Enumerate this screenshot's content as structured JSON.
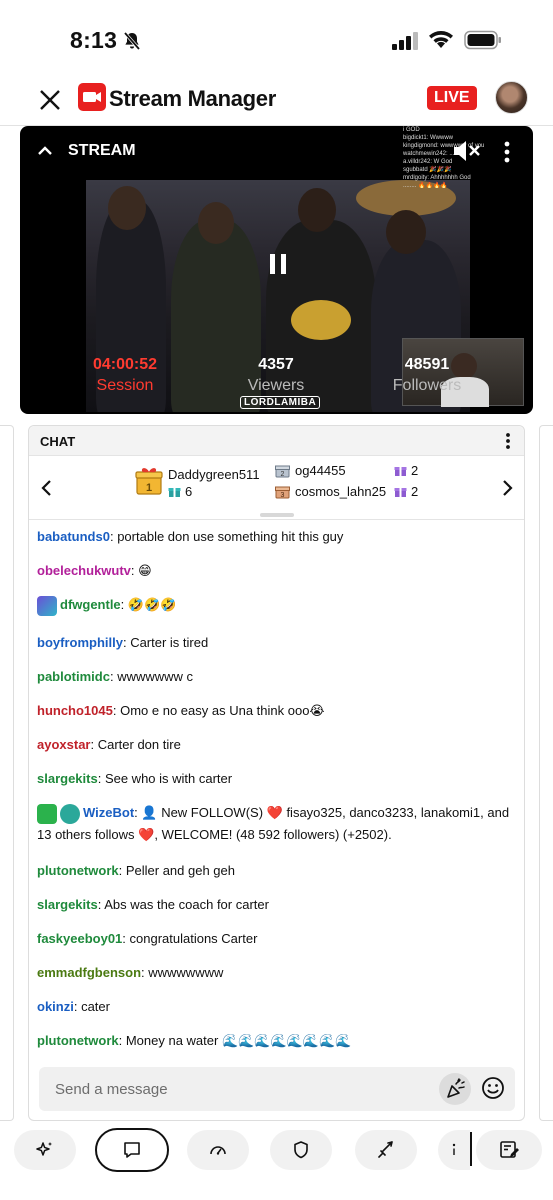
{
  "status": {
    "time": "8:13"
  },
  "header": {
    "title": "Stream Manager",
    "live": "LIVE"
  },
  "stream": {
    "section_label": "STREAM",
    "stats": [
      {
        "value": "04:00:52",
        "label": "Session"
      },
      {
        "value": "4357",
        "label": "Viewers"
      },
      {
        "value": "48591",
        "label": "Followers"
      }
    ],
    "watermark": "LORDLAMIBA",
    "mini_chat": [
      "i GOD",
      "bigdickt1: Wwwww",
      "kingdigmond: wwwwww of you",
      "watchmewin242: ......",
      "a.villdr242: W God",
      "sgubbatd 🎉🎉🎉",
      "mrdlgoity: Ahhhhhhh God",
      "........ 🔥🔥🔥🔥"
    ]
  },
  "chat": {
    "title": "CHAT",
    "gifters": [
      {
        "name": "Daddygreen511",
        "count": "6",
        "rank": "1"
      },
      {
        "name": "og44455",
        "count": "2",
        "rank": "2"
      },
      {
        "name": "cosmos_lahn25",
        "count": "2",
        "rank": "3"
      }
    ],
    "messages": [
      {
        "user": "babatunds0",
        "color": "#1a5ec2",
        "text": "portable don use something hit this guy"
      },
      {
        "user": "obelechukwutv",
        "color": "#b2209a",
        "text": "😁"
      },
      {
        "user": "dfwgentle",
        "color": "#1f8a3c",
        "text": "🤣🤣🤣"
      },
      {
        "user": "boyfromphilly",
        "color": "#1a5ec2",
        "text": "Carter is tired"
      },
      {
        "user": "pablotimidc",
        "color": "#1f8a3c",
        "text": "wwwwwww c"
      },
      {
        "user": "huncho1045",
        "color": "#c0222a",
        "text": "Omo e no easy as Una think ooo😭"
      },
      {
        "user": "ayoxstar",
        "color": "#c0222a",
        "text": "Carter don tire"
      },
      {
        "user": "slargekits",
        "color": "#1f8a3c",
        "text": "See who is with carter"
      },
      {
        "user": "WizeBot",
        "color": "#1a5ec2",
        "text": "👤 New FOLLOW(S) ❤️ fisayo325, danco3233, lanakomi1, and 13 others follows ❤️, WELCOME! (48 592 followers) (+2502)."
      },
      {
        "user": "plutonetwork",
        "color": "#1f8a3c",
        "text": "Peller and geh geh"
      },
      {
        "user": "slargekits",
        "color": "#1f8a3c",
        "text": "Abs was the coach for carter"
      },
      {
        "user": "faskyeeboy01",
        "color": "#1f8a3c",
        "text": "congratulations Carter"
      },
      {
        "user": "emmadfgbenson",
        "color": "#4b7a12",
        "text": "wwwwwwww"
      },
      {
        "user": "okinzi",
        "color": "#1a5ec2",
        "text": "cater"
      },
      {
        "user": "plutonetwork",
        "color": "#1f8a3c",
        "text": "Money na water 🌊🌊🌊🌊🌊🌊🌊🌊"
      }
    ],
    "input_placeholder": "Send a message"
  },
  "toolbar": {
    "icons": [
      "sparkle-icon",
      "chat-icon",
      "dashboard-icon",
      "shield-icon",
      "sword-icon",
      "info-icon",
      "edit-layout-icon"
    ]
  },
  "colors": {
    "accent": "#e8201f",
    "session": "#ff3b30"
  }
}
